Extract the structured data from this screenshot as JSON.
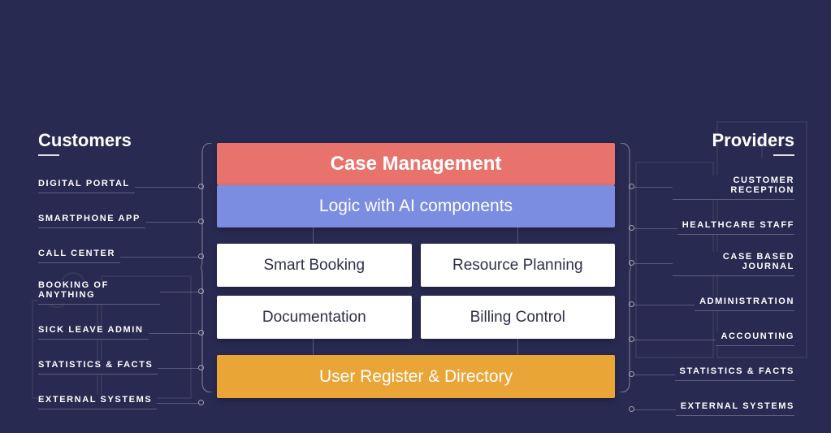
{
  "left": {
    "title": "Customers",
    "items": [
      {
        "label": "DIGITAL PORTAL"
      },
      {
        "label": "SMARTPHONE APP"
      },
      {
        "label": "CALL CENTER"
      },
      {
        "label": "BOOKING OF ANYTHING"
      },
      {
        "label": "SICK LEAVE ADMIN"
      },
      {
        "label": "STATISTICS & FACTS"
      },
      {
        "label": "EXTERNAL SYSTEMS"
      }
    ]
  },
  "right": {
    "title": "Providers",
    "items": [
      {
        "label": "CUSTOMER RECEPTION"
      },
      {
        "label": "HEALTHCARE STAFF"
      },
      {
        "label": "CASE BASED JOURNAL"
      },
      {
        "label": "ADMINISTRATION"
      },
      {
        "label": "ACCOUNTING"
      },
      {
        "label": "STATISTICS & FACTS"
      },
      {
        "label": "EXTERNAL SYSTEMS"
      }
    ]
  },
  "center": {
    "top": "Case Management",
    "logic": "Logic with AI components",
    "cells": [
      "Smart Booking",
      "Resource Planning",
      "Documentation",
      "Billing Control"
    ],
    "bottom": "User Register & Directory"
  }
}
